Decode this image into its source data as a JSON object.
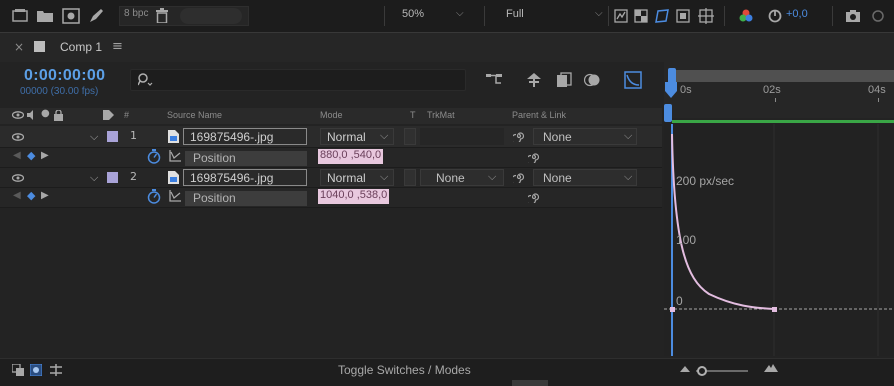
{
  "toolbar": {
    "bit_depth": "8 bpc",
    "zoom": "50%",
    "resolution": "Full",
    "exposure": "+0,0"
  },
  "panel": {
    "tab_title": "Comp 1"
  },
  "timeline": {
    "timecode": "0:00:00:00",
    "fps": "00000 (30.00 fps)",
    "search_placeholder": ""
  },
  "columns": {
    "source_name": "Source Name",
    "mode": "Mode",
    "t": "T",
    "trkmat": "TrkMat",
    "parent_link": "Parent & Link",
    "hash": "#"
  },
  "layers": [
    {
      "number": "1",
      "source": "169875496-.jpg",
      "mode": "Normal",
      "trkmat": "",
      "parent": "None",
      "property": "Position",
      "value": "880,0 ,540,0"
    },
    {
      "number": "2",
      "source": "169875496-.jpg",
      "mode": "Normal",
      "trkmat": "None",
      "parent": "None",
      "property": "Position",
      "value": "1040,0 ,538,0"
    }
  ],
  "ruler": {
    "ticks": [
      "0s",
      "02s",
      "04s"
    ]
  },
  "graph": {
    "label_top": "200 px/sec",
    "label_mid": "100",
    "label_bottom": "0"
  },
  "bottom": {
    "toggle_label": "Toggle Switches / Modes"
  },
  "colors": {
    "accent_blue": "#5c9fe6",
    "label_lavender": "#a9a3d8",
    "value_pink": "#e8c8de",
    "curve_pink": "#e3bde0",
    "work_area_green": "#3aa646"
  }
}
